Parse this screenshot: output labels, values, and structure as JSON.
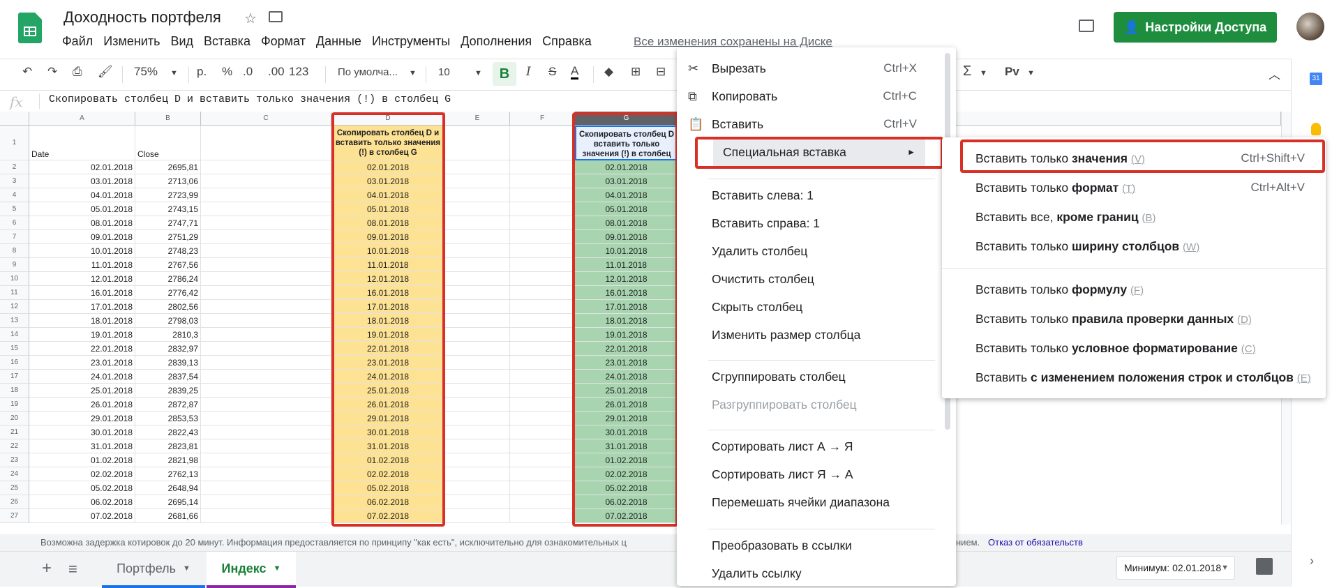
{
  "header": {
    "title": "Доходность портфеля",
    "menu": [
      "Файл",
      "Изменить",
      "Вид",
      "Вставка",
      "Формат",
      "Данные",
      "Инструменты",
      "Дополнения",
      "Справка"
    ],
    "saved_status": "Все изменения сохранены на Диске",
    "share_label": "Настройки Доступа"
  },
  "toolbar": {
    "zoom": "75%",
    "currency": "р.",
    "percent": "%",
    "dec_less": ".0",
    "dec_more": ".00",
    "format_more": "123",
    "font": "По умолча...",
    "font_size": "10",
    "bold": "B",
    "italic": "I",
    "strike": "S",
    "text_color": "A",
    "sum": "Σ",
    "pv": "Pv"
  },
  "formula_bar": {
    "fx": "fx",
    "content": "Скопировать столбец D и вставить только значения (!) в столбец G"
  },
  "grid": {
    "columns": [
      "A",
      "B",
      "C",
      "D",
      "E",
      "F",
      "G"
    ],
    "header_row": {
      "A": "Date",
      "B": "Close",
      "D": "Скопировать столбец D и вставить только значения (!) в столбец G",
      "G": "Скопировать столбец D вставить только значения (!) в столбец"
    },
    "rows": [
      [
        "02.01.2018",
        "2695,81"
      ],
      [
        "03.01.2018",
        "2713,06"
      ],
      [
        "04.01.2018",
        "2723,99"
      ],
      [
        "05.01.2018",
        "2743,15"
      ],
      [
        "08.01.2018",
        "2747,71"
      ],
      [
        "09.01.2018",
        "2751,29"
      ],
      [
        "10.01.2018",
        "2748,23"
      ],
      [
        "11.01.2018",
        "2767,56"
      ],
      [
        "12.01.2018",
        "2786,24"
      ],
      [
        "16.01.2018",
        "2776,42"
      ],
      [
        "17.01.2018",
        "2802,56"
      ],
      [
        "18.01.2018",
        "2798,03"
      ],
      [
        "19.01.2018",
        "2810,3"
      ],
      [
        "22.01.2018",
        "2832,97"
      ],
      [
        "23.01.2018",
        "2839,13"
      ],
      [
        "24.01.2018",
        "2837,54"
      ],
      [
        "25.01.2018",
        "2839,25"
      ],
      [
        "26.01.2018",
        "2872,87"
      ],
      [
        "29.01.2018",
        "2853,53"
      ],
      [
        "30.01.2018",
        "2822,43"
      ],
      [
        "31.01.2018",
        "2823,81"
      ],
      [
        "01.02.2018",
        "2821,98"
      ],
      [
        "02.02.2018",
        "2762,13"
      ],
      [
        "05.02.2018",
        "2648,94"
      ],
      [
        "06.02.2018",
        "2695,14"
      ],
      [
        "07.02.2018",
        "2681,66"
      ]
    ]
  },
  "context_menu": {
    "items": [
      {
        "icon": "✂",
        "label": "Вырезать",
        "shortcut": "Ctrl+X"
      },
      {
        "icon": "⧉",
        "label": "Копировать",
        "shortcut": "Ctrl+C"
      },
      {
        "icon": "📋",
        "label": "Вставить",
        "shortcut": "Ctrl+V"
      },
      {
        "label": "Специальная вставка",
        "arrow": "►"
      },
      {
        "label": "Вставить слева: 1"
      },
      {
        "label": "Вставить справа: 1"
      },
      {
        "label": "Удалить столбец"
      },
      {
        "label": "Очистить столбец"
      },
      {
        "label": "Скрыть столбец"
      },
      {
        "label": "Изменить размер столбца"
      },
      {
        "label": "Сгруппировать столбец"
      },
      {
        "label": "Разгруппировать столбец"
      },
      {
        "label": "Сортировать лист А → Я"
      },
      {
        "label": "Сортировать лист Я → А"
      },
      {
        "label": "Перемешать ячейки диапазона"
      },
      {
        "label": "Преобразовать в ссылки"
      },
      {
        "label": "Удалить ссылку"
      }
    ]
  },
  "submenu": {
    "items": [
      {
        "pre": "Вставить только ",
        "bold": "значения",
        "key": "(V)",
        "shortcut": "Ctrl+Shift+V"
      },
      {
        "pre": "Вставить только ",
        "bold": "формат",
        "key": "(T)",
        "shortcut": "Ctrl+Alt+V"
      },
      {
        "pre": "Вставить все, ",
        "bold": "кроме границ",
        "key": "(B)"
      },
      {
        "pre": "Вставить только ",
        "bold": "ширину столбцов",
        "key": "(W)"
      },
      {
        "pre": "Вставить только ",
        "bold": "формулу",
        "key": "(F)"
      },
      {
        "pre": "Вставить только ",
        "bold": "правила проверки данных",
        "key": "(D)"
      },
      {
        "pre": "Вставить только ",
        "bold": "условное форматирование",
        "key": "(C)"
      },
      {
        "pre": "Вставить ",
        "bold": "с изменением положения строк и столбцов",
        "key": "(E)"
      }
    ]
  },
  "footer": {
    "disclaimer_left": "Возможна задержка котировок до 20 минут. Информация предоставляется по принципу \"как есть\", исключительно для ознакомительных ц",
    "disclaimer_right": "нием.",
    "disclaimer_link": "Отказ от обязательств",
    "tabs": [
      "Портфель",
      "Индекс"
    ],
    "active_tab": "Индекс",
    "minimum_label": "Минимум: 02.01.2018"
  },
  "colors": {
    "brand_green": "#1e8e3e",
    "highlight_yellow": "#fde293",
    "highlight_green": "#a8d5b0",
    "annotation_red": "#d93025",
    "tab_blue": "#1a73e8",
    "tab_purple": "#8e24aa"
  }
}
